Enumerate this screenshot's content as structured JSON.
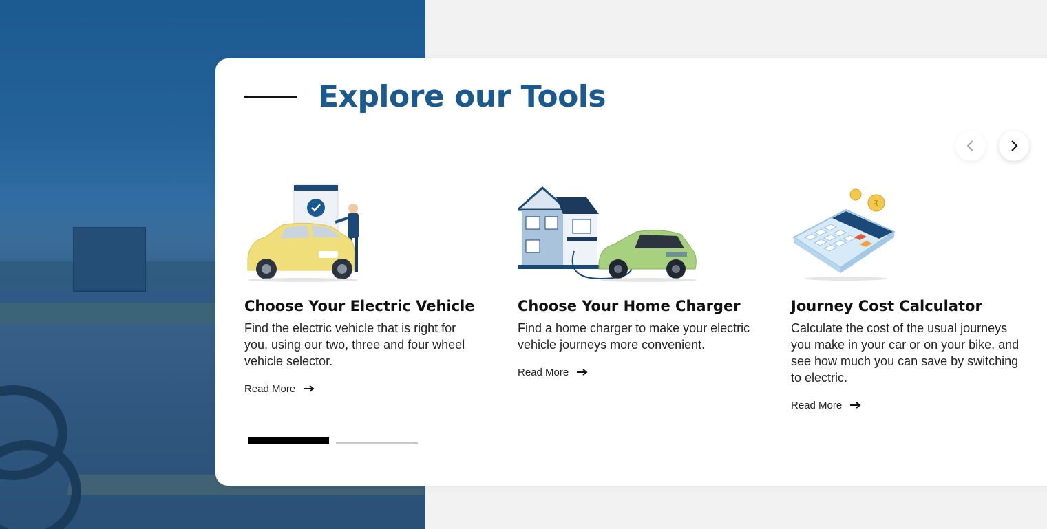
{
  "section": {
    "title": "Explore our Tools"
  },
  "tools": [
    {
      "title": "Choose Your Electric Vehicle",
      "description": "Find the electric vehicle that is right for you, using our two, three and four wheel vehicle selector.",
      "link_label": "Read More",
      "icon": "ev-selector-illustration"
    },
    {
      "title": "Choose Your Home Charger",
      "description": "Find a home charger to make your electric vehicle journeys more convenient.",
      "link_label": "Read More",
      "icon": "home-charger-illustration"
    },
    {
      "title": "Journey Cost Calculator",
      "description": "Calculate the cost of the usual journeys you make in your car or on your bike, and see how much you can save by switching to electric.",
      "link_label": "Read More",
      "icon": "calculator-illustration"
    }
  ],
  "carousel": {
    "prev_icon": "chevron-left-icon",
    "next_icon": "chevron-right-icon",
    "active_page": 1,
    "page_count": 2
  },
  "colors": {
    "title": "#1b5a8f",
    "text": "#111111",
    "progress_active": "#000000",
    "progress_inactive": "#c8c8c8"
  }
}
